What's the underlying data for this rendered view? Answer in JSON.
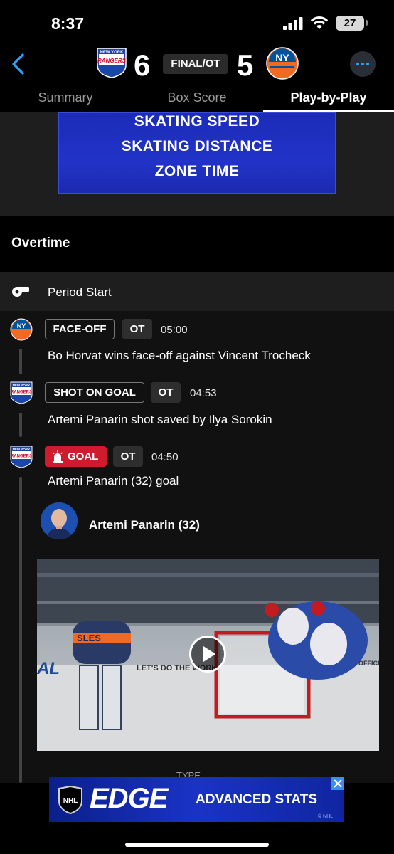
{
  "status_bar": {
    "time": "8:37",
    "battery": "27"
  },
  "header": {
    "home_score": "6",
    "away_score": "5",
    "game_status": "FINAL/OT",
    "home_logo_text": [
      "NEW YORK",
      "RANGERS"
    ],
    "away_logo_text": "NY"
  },
  "tabs": [
    {
      "label": "Summary"
    },
    {
      "label": "Box Score"
    },
    {
      "label": "Play-by-Play"
    }
  ],
  "banner": {
    "lines": [
      "SKATING SPEED",
      "SKATING DISTANCE",
      "ZONE TIME"
    ]
  },
  "section": {
    "title": "Overtime"
  },
  "period_start": {
    "label": "Period Start"
  },
  "events": [
    {
      "type": "FACE-OFF",
      "period": "OT",
      "time": "05:00",
      "description": "Bo Horvat wins face-off against Vincent Trocheck"
    },
    {
      "type": "SHOT ON GOAL",
      "period": "OT",
      "time": "04:53",
      "description": "Artemi Panarin shot saved by Ilya Sorokin"
    },
    {
      "type": "GOAL",
      "period": "OT",
      "time": "04:50",
      "description": "Artemi Panarin (32) goal",
      "scorer": "Artemi Panarin (32)"
    }
  ],
  "video": {
    "jersey_text": "SLES",
    "board_text": "LET'S DO THE WORK",
    "sponsor_text": "OFFICIAL TRADING"
  },
  "partial_row": {
    "label": "TYPE"
  },
  "ad": {
    "brand": "EDGE",
    "text": "ADVANCED STATS",
    "badge": "NHL",
    "copyright": "© NHL"
  },
  "colors": {
    "accent": "#2aa3ff",
    "goal": "#d01a2e",
    "banner": "#1b2cb8"
  }
}
